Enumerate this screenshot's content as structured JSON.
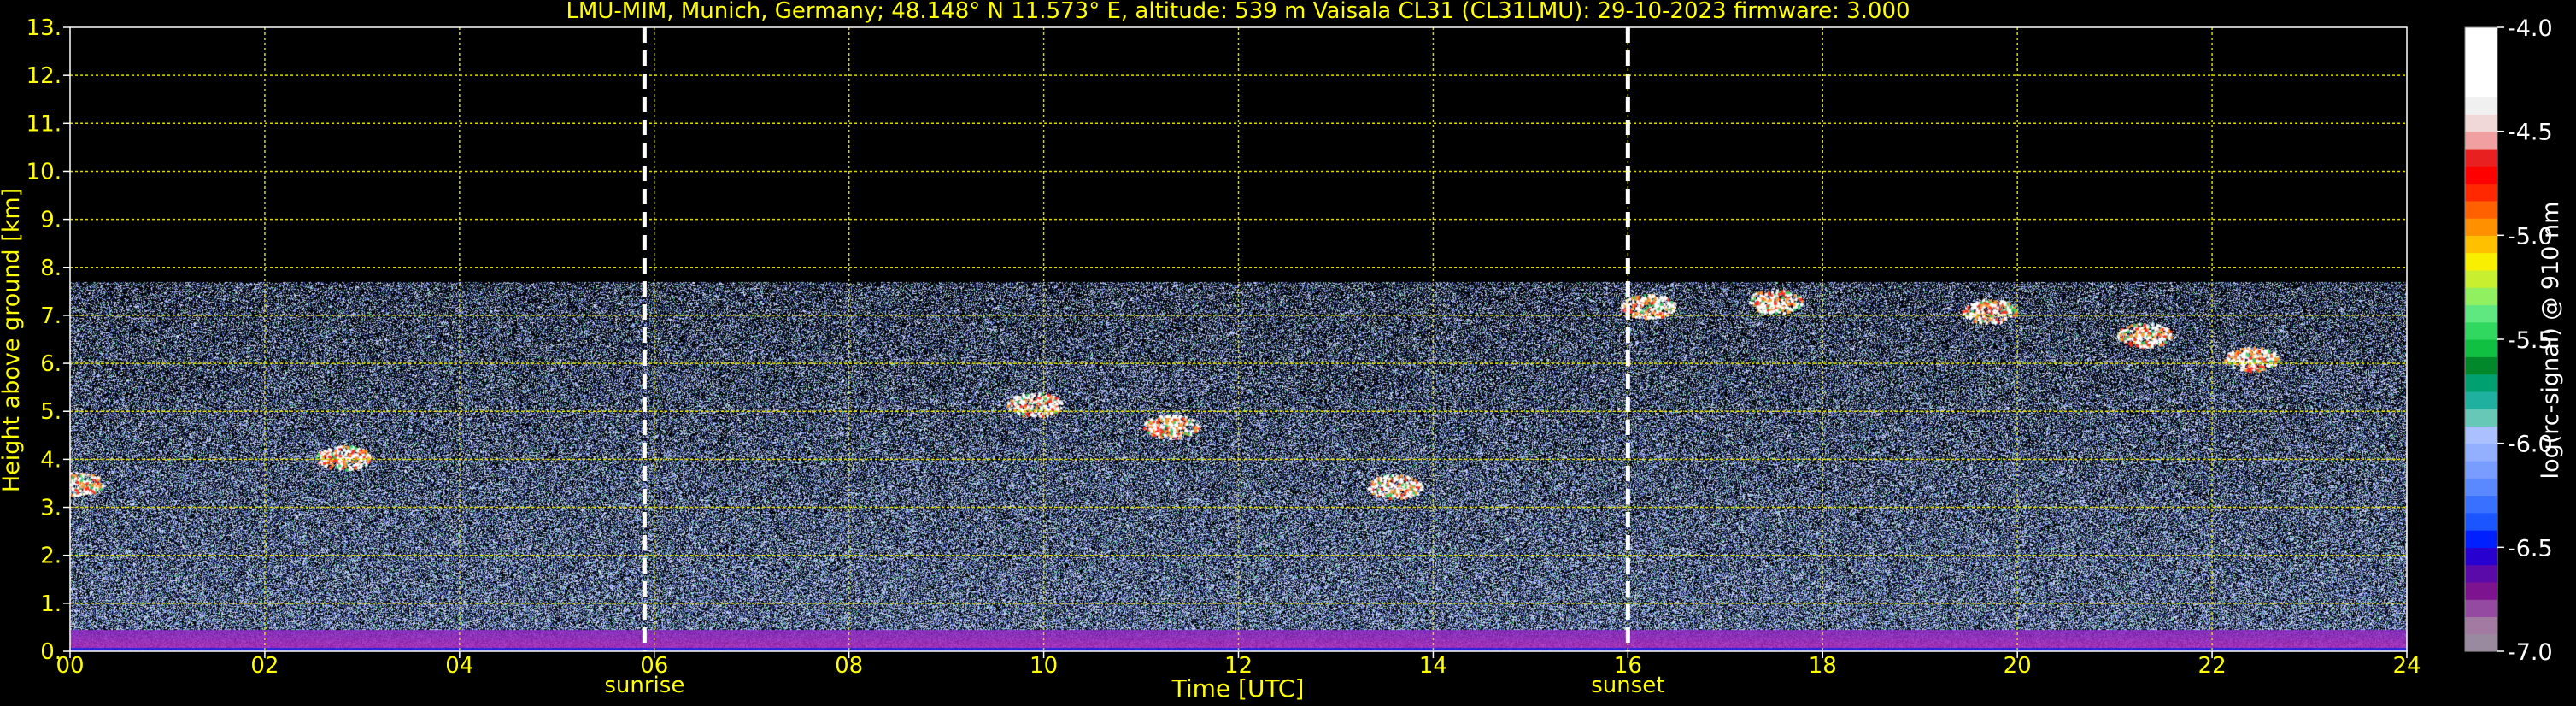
{
  "chart_data": {
    "type": "heatmap",
    "title": "LMU-MIM, Munich, Germany; 48.148° N 11.573° E, altitude: 539 m    Vaisala CL31 (CL31LMU): 29-10-2023    firmware: 3.000",
    "xlabel": "Time [UTC]",
    "ylabel": "Height above ground [km]",
    "xlim": [
      0,
      24
    ],
    "ylim": [
      0,
      13
    ],
    "x_ticks": [
      0,
      2,
      4,
      6,
      8,
      10,
      12,
      14,
      16,
      18,
      20,
      22,
      24
    ],
    "x_tick_labels": [
      "00",
      "02",
      "04",
      "06",
      "08",
      "10",
      "12",
      "14",
      "16",
      "18",
      "20",
      "22",
      "24"
    ],
    "y_ticks": [
      0,
      1,
      2,
      3,
      4,
      5,
      6,
      7,
      8,
      9,
      10,
      11,
      12,
      13
    ],
    "y_tick_labels": [
      "0.",
      "1.",
      "2.",
      "3.",
      "4.",
      "5.",
      "6.",
      "7.",
      "8.",
      "9.",
      "10.",
      "11.",
      "12.",
      "13."
    ],
    "grid": true,
    "data_top_km": 7.7,
    "markers": [
      {
        "label": "sunrise",
        "time": 5.9
      },
      {
        "label": "sunset",
        "time": 16.0
      }
    ],
    "colorbar": {
      "label": "log(rc-signal) @ 910 nm",
      "range": [
        -7.0,
        -4.0
      ],
      "ticks": [
        -4.0,
        -4.5,
        -5.0,
        -5.5,
        -6.0,
        -6.5,
        -7.0
      ],
      "tick_labels": [
        "-4.0",
        "-4.5",
        "-5.0",
        "-5.5",
        "-6.0",
        "-6.5",
        "-7.0"
      ],
      "colors": [
        "#9a8aa0",
        "#a37aa2",
        "#944aa0",
        "#7d138f",
        "#5a0aa8",
        "#2800d0",
        "#0020ff",
        "#1a55ff",
        "#3a70ff",
        "#5a88ff",
        "#789cff",
        "#92b0ff",
        "#aac0ff",
        "#68c8b8",
        "#20b0a0",
        "#00a070",
        "#00882a",
        "#10c040",
        "#30d860",
        "#60e880",
        "#90f060",
        "#c8f030",
        "#f8f000",
        "#ffc000",
        "#ff9000",
        "#ff6000",
        "#ff2800",
        "#ff0000",
        "#e82020",
        "#f0a0a0",
        "#f0d8d8",
        "#f0f0f0",
        "#ffffff",
        "#ffffff",
        "#ffffff",
        "#ffffff"
      ]
    },
    "features": [
      {
        "type": "surface_layer",
        "t0": 0,
        "t1": 24,
        "h0": 0,
        "h1": 0.45
      },
      {
        "type": "cloud",
        "t": 2.8,
        "h": 4.05
      },
      {
        "type": "cloud",
        "t": 0.05,
        "h": 3.5
      },
      {
        "type": "cloud",
        "t": 9.9,
        "h": 5.15
      },
      {
        "type": "cloud",
        "t": 11.3,
        "h": 4.7
      },
      {
        "type": "cloud",
        "t": 13.6,
        "h": 3.45
      },
      {
        "type": "cloud",
        "t": 16.2,
        "h": 7.2
      },
      {
        "type": "cloud",
        "t": 17.5,
        "h": 7.3
      },
      {
        "type": "cloud",
        "t": 19.7,
        "h": 7.1
      },
      {
        "type": "cloud",
        "t": 21.3,
        "h": 6.6
      },
      {
        "type": "cloud",
        "t": 22.4,
        "h": 6.1
      }
    ]
  }
}
